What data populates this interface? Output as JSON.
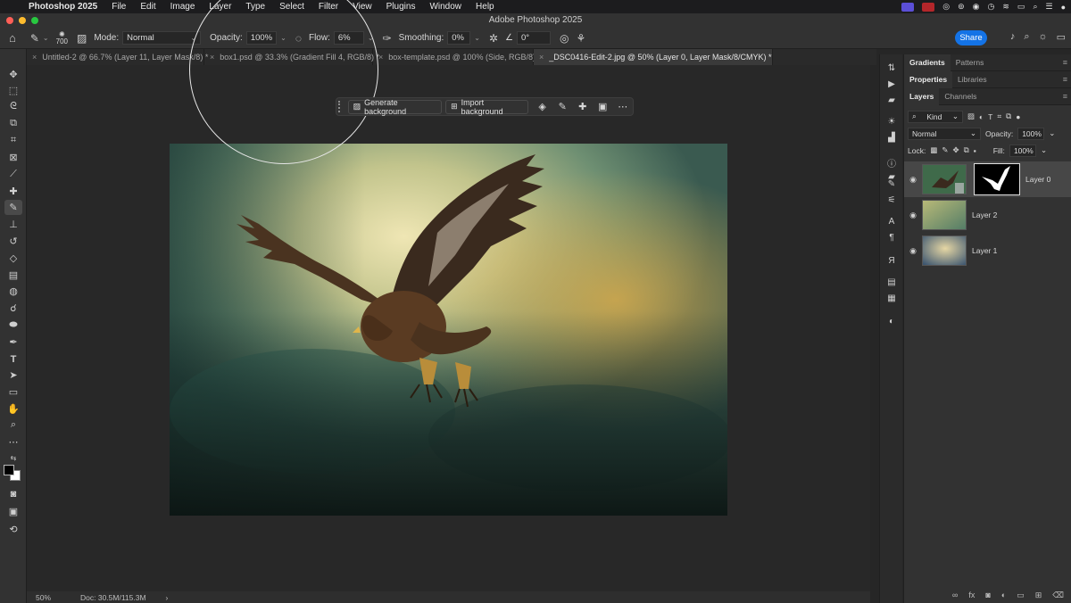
{
  "menubar": {
    "app_name": "Photoshop 2025",
    "items": [
      "File",
      "Edit",
      "Image",
      "Layer",
      "Type",
      "Select",
      "Filter",
      "View",
      "Plugins",
      "Window",
      "Help"
    ]
  },
  "window": {
    "title": "Adobe Photoshop 2025"
  },
  "options_bar": {
    "brush_size": "700",
    "mode_label": "Mode:",
    "mode_value": "Normal",
    "opacity_label": "Opacity:",
    "opacity_value": "100%",
    "flow_label": "Flow:",
    "flow_value": "6%",
    "smoothing_label": "Smoothing:",
    "smoothing_value": "0%",
    "angle_value": "0°",
    "share_label": "Share"
  },
  "doc_tabs": [
    {
      "label": "Untitled-2 @ 66.7% (Layer 11, Layer Mask/8) *",
      "active": false
    },
    {
      "label": "box1.psd @ 33.3% (Gradient Fill 4, RGB/8) *",
      "active": false
    },
    {
      "label": "box-template.psd @ 100% (Side, RGB/8) *",
      "active": false
    },
    {
      "label": "_DSC0416-Edit-2.jpg @ 50% (Layer 0, Layer Mask/8/CMYK) *",
      "active": true
    }
  ],
  "task_bar": {
    "generate_label": "Generate background",
    "import_label": "Import background"
  },
  "status_bar": {
    "zoom": "50%",
    "doc_info": "Doc: 30.5M/115.3M"
  },
  "panels": {
    "top_tabs": [
      "Gradients",
      "Patterns"
    ],
    "mid_tabs": [
      "Properties",
      "Libraries"
    ],
    "layer_tabs": [
      "Layers",
      "Channels"
    ],
    "kind_label": "Kind",
    "blend_mode": "Normal",
    "opacity_label": "Opacity:",
    "opacity_value": "100%",
    "lock_label": "Lock:",
    "fill_label": "Fill:",
    "fill_value": "100%",
    "layers": [
      {
        "name": "Layer 0",
        "active": true
      },
      {
        "name": "Layer 2",
        "active": false
      },
      {
        "name": "Layer 1",
        "active": false
      }
    ]
  },
  "colors": {
    "accent": "#1473e6",
    "panel_bg": "#323232",
    "canvas_bg": "#282828"
  }
}
